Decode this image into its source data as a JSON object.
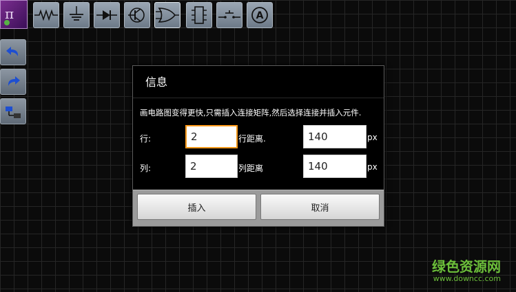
{
  "dialog": {
    "title": "信息",
    "message": "画电路图变得更快,只需插入连接矩阵,然后选择连接并插入元件.",
    "rows_label": "行:",
    "rows_value": "2",
    "row_spacing_label": "行距离.",
    "row_spacing_value": "140",
    "cols_label": "列:",
    "cols_value": "2",
    "col_spacing_label": "列距离",
    "col_spacing_value": "140",
    "unit": "px",
    "insert_button": "插入",
    "cancel_button": "取消"
  },
  "toolbar": {
    "tools": [
      "resistor-icon",
      "capacitor-icon",
      "diode-icon",
      "transistor-icon",
      "logic-gate-icon",
      "chip-icon",
      "switch-icon",
      "ammeter-icon"
    ],
    "ammeter_letter": "A"
  },
  "sidebar": {
    "tools": [
      "undo-icon",
      "redo-icon",
      "move-icon"
    ]
  },
  "watermark": {
    "text": "绿色资源网",
    "url": "www.downcc.com"
  },
  "colors": {
    "focus_border": "#ff9a1a",
    "toolbar_button": "#8593a1",
    "watermark": "#6cbf3a"
  }
}
